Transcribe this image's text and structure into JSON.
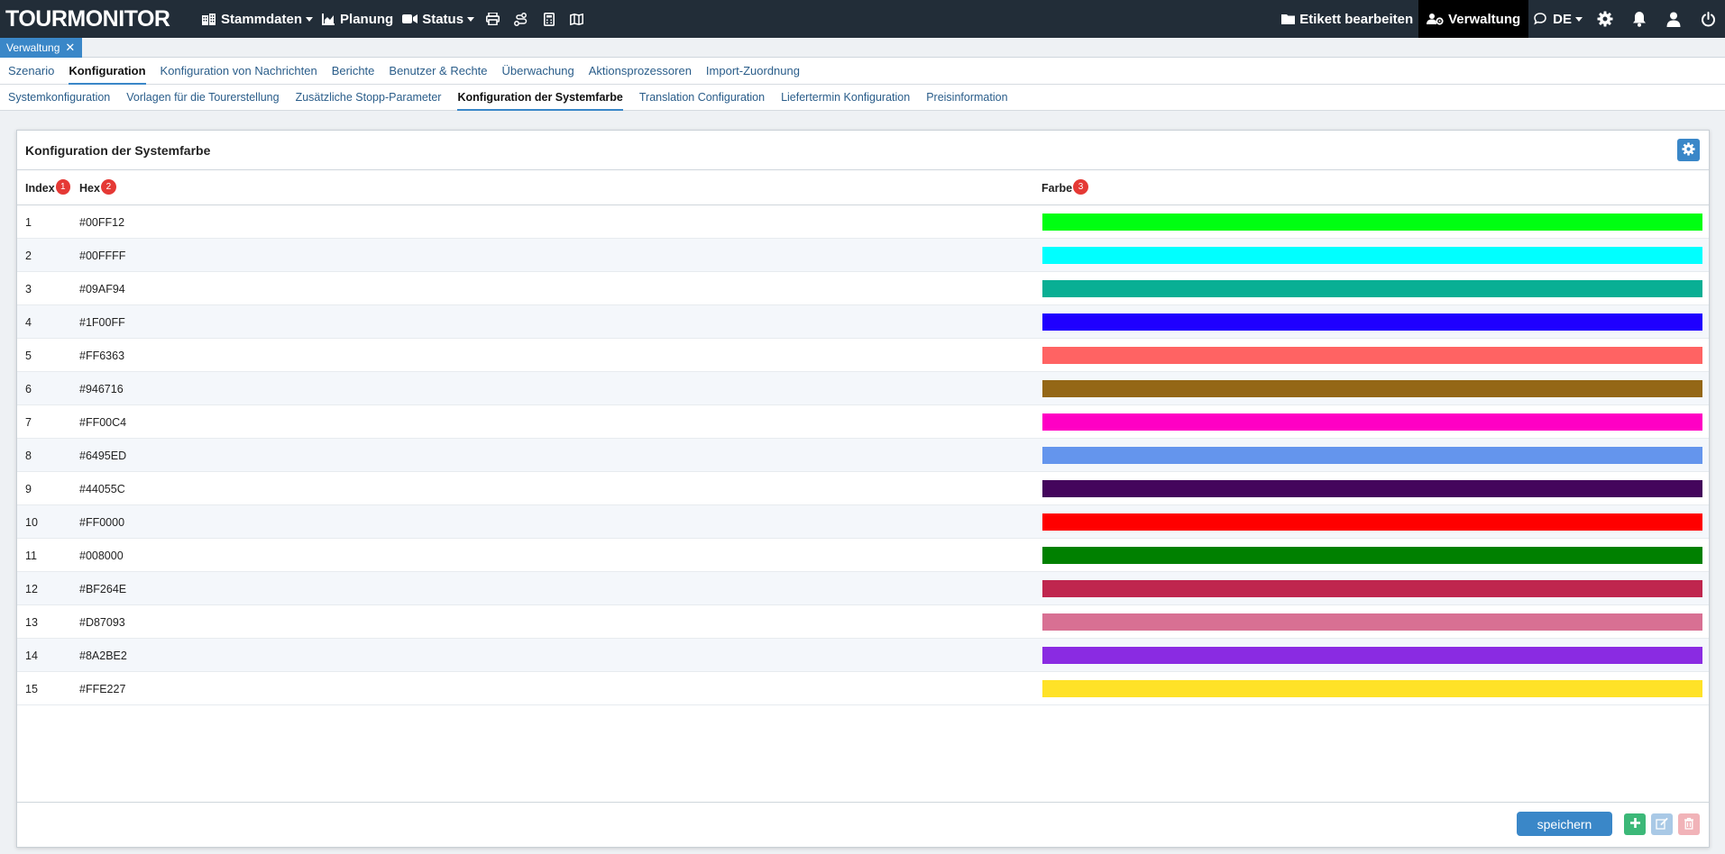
{
  "app": {
    "logo": "TOURMONITOR"
  },
  "nav": {
    "stammdaten": "Stammdaten",
    "planung": "Planung",
    "status": "Status",
    "etikett": "Etikett bearbeiten",
    "verwaltung": "Verwaltung",
    "language": "DE"
  },
  "open_tab": {
    "label": "Verwaltung",
    "close": "✕"
  },
  "main_tabs": [
    {
      "label": "Szenario"
    },
    {
      "label": "Konfiguration"
    },
    {
      "label": "Konfiguration von Nachrichten"
    },
    {
      "label": "Berichte"
    },
    {
      "label": "Benutzer & Rechte"
    },
    {
      "label": "Überwachung"
    },
    {
      "label": "Aktionsprozessoren"
    },
    {
      "label": "Import-Zuordnung"
    }
  ],
  "sub_tabs": [
    {
      "label": "Systemkonfiguration"
    },
    {
      "label": "Vorlagen für die Tourerstellung"
    },
    {
      "label": "Zusätzliche Stopp-Parameter"
    },
    {
      "label": "Konfiguration der Systemfarbe"
    },
    {
      "label": "Translation Configuration"
    },
    {
      "label": "Liefertermin Konfiguration"
    },
    {
      "label": "Preisinformation"
    }
  ],
  "panel": {
    "title": "Konfiguration der Systemfarbe",
    "columns": {
      "index": "Index",
      "index_badge": "1",
      "hex": "Hex",
      "hex_badge": "2",
      "farbe": "Farbe",
      "farbe_badge": "3"
    },
    "rows": [
      {
        "index": "1",
        "hex": "#00FF12"
      },
      {
        "index": "2",
        "hex": "#00FFFF"
      },
      {
        "index": "3",
        "hex": "#09AF94"
      },
      {
        "index": "4",
        "hex": "#1F00FF"
      },
      {
        "index": "5",
        "hex": "#FF6363"
      },
      {
        "index": "6",
        "hex": "#946716"
      },
      {
        "index": "7",
        "hex": "#FF00C4"
      },
      {
        "index": "8",
        "hex": "#6495ED"
      },
      {
        "index": "9",
        "hex": "#44055C"
      },
      {
        "index": "10",
        "hex": "#FF0000"
      },
      {
        "index": "11",
        "hex": "#008000"
      },
      {
        "index": "12",
        "hex": "#BF264E"
      },
      {
        "index": "13",
        "hex": "#D87093"
      },
      {
        "index": "14",
        "hex": "#8A2BE2"
      },
      {
        "index": "15",
        "hex": "#FFE227"
      }
    ],
    "save_label": "speichern"
  },
  "colors": {
    "navbar": "#222d38",
    "accent": "#3a87c8",
    "badge": "#e53935",
    "add_button": "#3cb878"
  }
}
